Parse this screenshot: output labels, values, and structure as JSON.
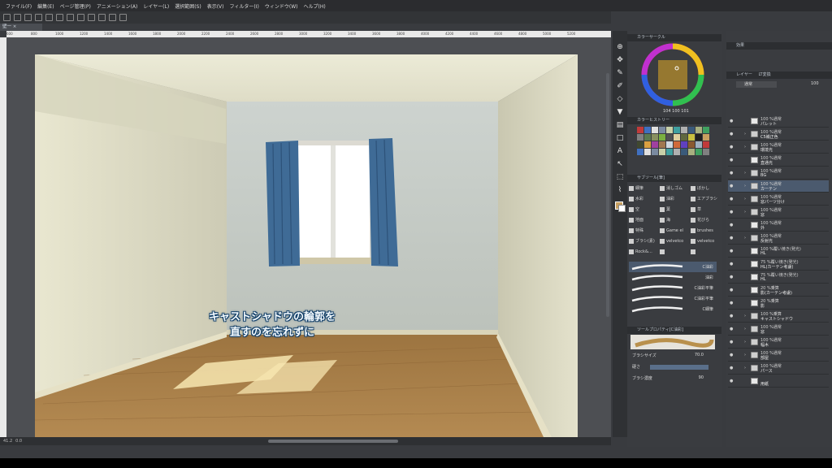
{
  "menu": [
    "ファイル(F)",
    "編集(E)",
    "ページ管理(P)",
    "アニメーション(A)",
    "レイヤー(L)",
    "選択範囲(S)",
    "表示(V)",
    "フィルター(I)",
    "ウィンドウ(W)",
    "ヘルプ(H)"
  ],
  "doc_tab": "壁一",
  "ruler_labels": [
    "600",
    "800",
    "1000",
    "1200",
    "1400",
    "1600",
    "1800",
    "2000",
    "2200",
    "2400",
    "2600",
    "2800",
    "3000",
    "3200",
    "3400",
    "3600",
    "3800",
    "4000",
    "4200",
    "4400",
    "4600",
    "4800",
    "5000",
    "5200"
  ],
  "caption": {
    "line1": "キャストシャドウの輪郭を",
    "line2": "直すのを忘れずに"
  },
  "status": {
    "zoom": "41.2",
    "angle": "0.0"
  },
  "color_panel": {
    "title": "カラーサークル",
    "hsv": [
      "104",
      "100",
      "101"
    ]
  },
  "history_panel": {
    "title": "カラーヒストリー"
  },
  "subtool": {
    "title": "サブツール[筆]",
    "col1": [
      "細筆",
      "水彩",
      "空",
      "地面",
      "特殊",
      "ブラシ(素)",
      "Rock&…"
    ],
    "col2": [
      "消しゴム",
      "油彩",
      "葉",
      "海",
      "Game el",
      "velvetco",
      ""
    ],
    "col3": [
      "ぼかし",
      "エアブラシ",
      "草",
      "花びら",
      "brushes",
      "velvetco",
      ""
    ],
    "brushes": [
      "C油彩",
      "油彩",
      "C油彩平筆",
      "C油彩平筆",
      "C細筆"
    ]
  },
  "tool_property": {
    "title": "ツールプロパティ[C油彩]",
    "brush_size_label": "ブラシサイズ",
    "brush_size": "70.0",
    "hardness_label": "硬さ",
    "density_label": "ブラシ濃度",
    "density": "90"
  },
  "right_top": {
    "title": "効果"
  },
  "layer_panel": {
    "tab1": "レイヤー",
    "tab2": "LT変換",
    "blend": "通常",
    "opacity": "100",
    "layers": [
      {
        "t1": "100 %通常",
        "t2": "パレット",
        "kind": "layer",
        "sel": false
      },
      {
        "t1": "100 %通常",
        "t2": "C5補正色",
        "kind": "folder",
        "sel": false
      },
      {
        "t1": "100 %通常",
        "t2": "環境光",
        "kind": "folder",
        "sel": false
      },
      {
        "t1": "100 %通常",
        "t2": "直通光",
        "kind": "layer",
        "sel": false
      },
      {
        "t1": "100 %通常",
        "t2": "BG",
        "kind": "folder",
        "sel": false
      },
      {
        "t1": "100 %通常",
        "t2": "カーテン",
        "kind": "folder",
        "sel": true
      },
      {
        "t1": "100 %通常",
        "t2": "窓パーツ分け",
        "kind": "folder",
        "sel": false
      },
      {
        "t1": "100 %通常",
        "t2": "窓",
        "kind": "folder",
        "sel": false
      },
      {
        "t1": "100 %通常",
        "t2": "外",
        "kind": "layer",
        "sel": false
      },
      {
        "t1": "100 %通常",
        "t2": "反射光",
        "kind": "folder",
        "sel": false
      },
      {
        "t1": "100 %覆い焼き(発光)",
        "t2": "HL",
        "kind": "layer",
        "sel": false
      },
      {
        "t1": "75 %覆い焼き(発光)",
        "t2": "HL(カーテン考慮)",
        "kind": "layer",
        "sel": false
      },
      {
        "t1": "75 %覆い焼き(発光)",
        "t2": "HL",
        "kind": "layer",
        "sel": false
      },
      {
        "t1": "20 %乗算",
        "t2": "影(カーテン考慮)",
        "kind": "layer",
        "sel": false
      },
      {
        "t1": "20 %乗算",
        "t2": "影",
        "kind": "layer",
        "sel": false
      },
      {
        "t1": "100 %乗算",
        "t2": "キャストシャドウ",
        "kind": "folder",
        "sel": false
      },
      {
        "t1": "100 %通常",
        "t2": "窓",
        "kind": "folder",
        "sel": false
      },
      {
        "t1": "100 %通常",
        "t2": "幅木",
        "kind": "folder",
        "sel": false
      },
      {
        "t1": "100 %通常",
        "t2": "部屋",
        "kind": "folder",
        "sel": false
      },
      {
        "t1": "100 %通常",
        "t2": "パース",
        "kind": "folder",
        "sel": false
      },
      {
        "t1": "",
        "t2": "用紙",
        "kind": "layer",
        "sel": false
      }
    ]
  },
  "colors": {
    "bg": "#393b3f",
    "caption_stroke": "#13406a",
    "curtain": "#3f6b96",
    "floor": "#a87e45",
    "wall": "#d6d4c0"
  }
}
